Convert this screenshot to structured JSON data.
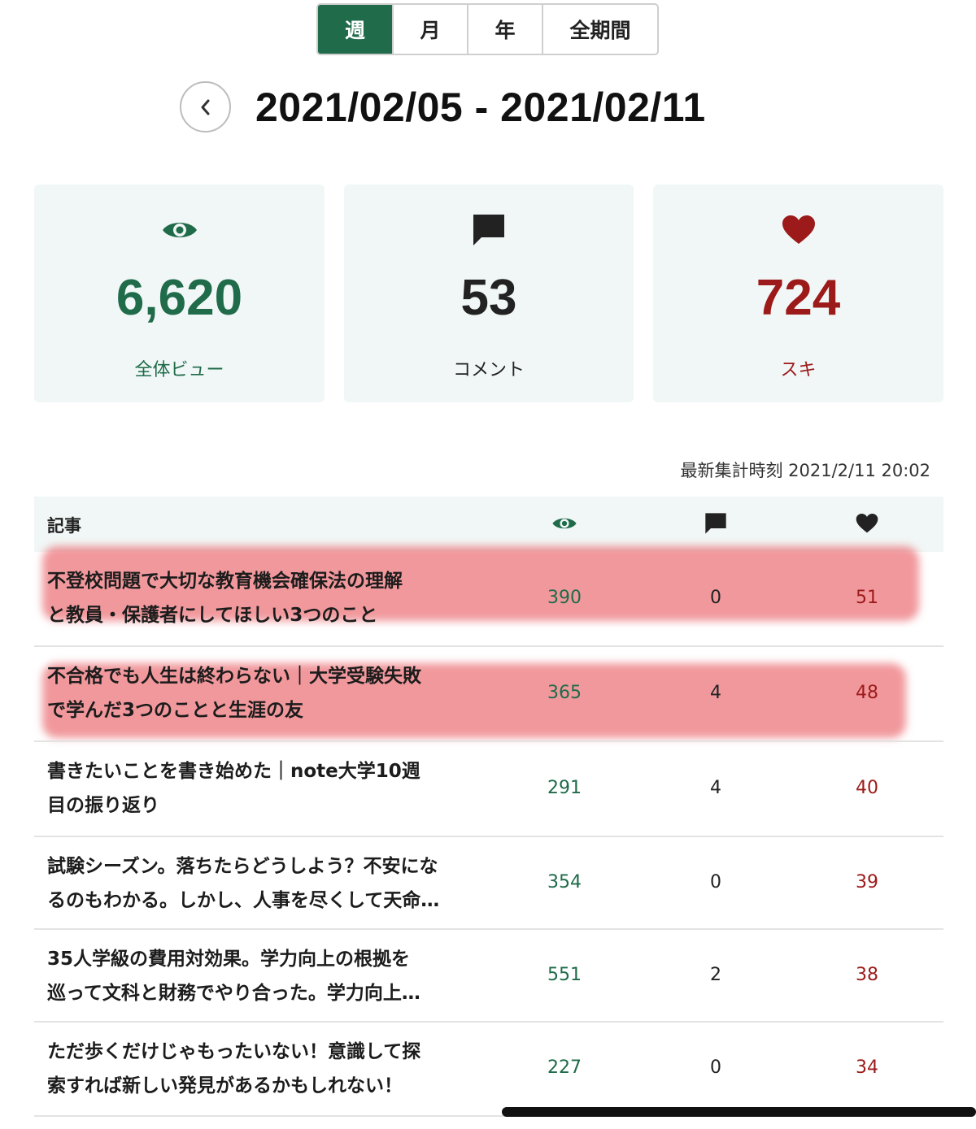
{
  "tabs": [
    {
      "label": "週",
      "active": true
    },
    {
      "label": "月"
    },
    {
      "label": "年"
    },
    {
      "label": "全期間"
    }
  ],
  "date_range": "2021/02/05 - 2021/02/11",
  "summary": {
    "views": {
      "value": "6,620",
      "label": "全体ビュー",
      "icon": "eye-icon",
      "color": "#1f6b4a"
    },
    "comments": {
      "value": "53",
      "label": "コメント",
      "icon": "comment-icon",
      "color": "#222222"
    },
    "likes": {
      "value": "724",
      "label": "スキ",
      "icon": "heart-icon",
      "color": "#9c1a1a"
    }
  },
  "updated": "最新集計時刻 2021/2/11 20:02",
  "table": {
    "header": "記事",
    "rows": [
      {
        "line1": "不登校問題で大切な教育機会確保法の理解",
        "line2": "と教員・保護者にしてほしい3つのこと",
        "views": "390",
        "comments": "0",
        "likes": "51",
        "highlighted": true
      },
      {
        "line1": "不合格でも人生は終わらない｜大学受験失敗",
        "line2": "で学んだ3つのことと生涯の友",
        "views": "365",
        "comments": "4",
        "likes": "48",
        "highlighted": true
      },
      {
        "line1": "書きたいことを書き始めた｜note大学10週",
        "line2": "目の振り返り",
        "views": "291",
        "comments": "4",
        "likes": "40"
      },
      {
        "line1": "試験シーズン。落ちたらどうしよう？不安にな",
        "line2": "るのもわかる。しかし、人事を尽くして天命…",
        "views": "354",
        "comments": "0",
        "likes": "39"
      },
      {
        "line1": "35人学級の費用対効果。学力向上の根拠を",
        "line2": "巡って文科と財務でやり合った。学力向上…",
        "views": "551",
        "comments": "2",
        "likes": "38"
      },
      {
        "line1": "ただ歩くだけじゃもったいない！意識して探",
        "line2": "索すれば新しい発見があるかもしれない！",
        "views": "227",
        "comments": "0",
        "likes": "34"
      }
    ]
  }
}
